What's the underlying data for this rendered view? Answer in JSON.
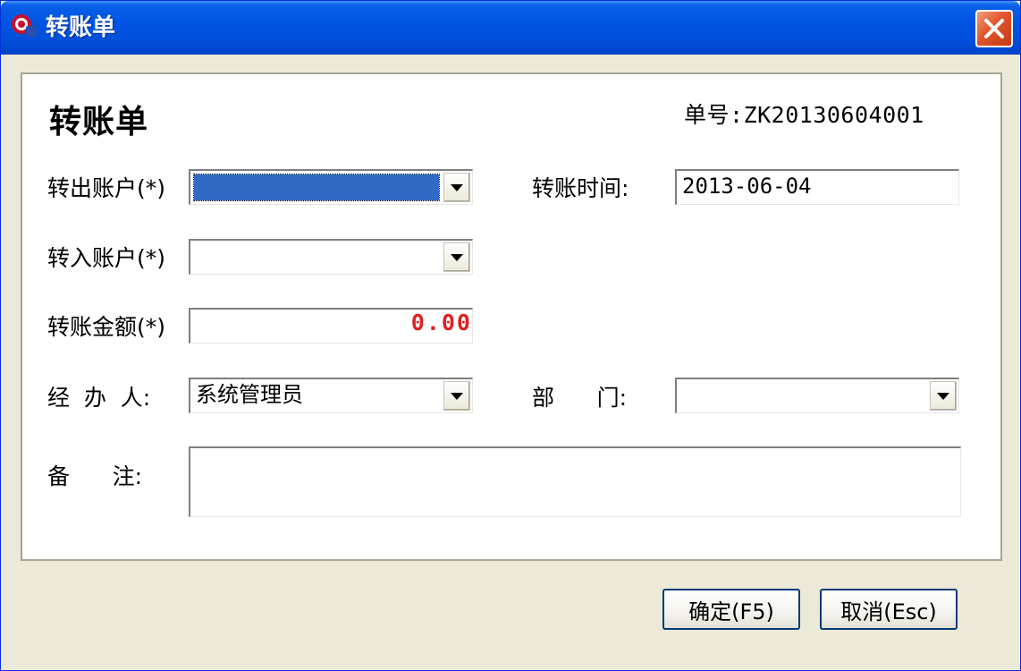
{
  "window": {
    "title": "转账单",
    "close_label": "✕"
  },
  "form": {
    "heading": "转账单",
    "order_no_label": "单号:",
    "order_no_value": "ZK20130604001",
    "from_account": {
      "label": "转出账户(*)",
      "value": ""
    },
    "to_account": {
      "label": "转入账户(*)",
      "value": ""
    },
    "amount": {
      "label": "转账金额(*)",
      "value": "0.00"
    },
    "time": {
      "label": "转账时间:",
      "value": "2013-06-04"
    },
    "handler": {
      "label": "经  办  人:",
      "value": "系统管理员"
    },
    "department": {
      "label": "部      门:",
      "value": ""
    },
    "remark": {
      "label": "备      注:",
      "value": ""
    }
  },
  "buttons": {
    "ok_label": "确定(F5)",
    "cancel_label": "取消(Esc)"
  },
  "colors": {
    "titlebar": "#0054e3",
    "selection": "#316ac5",
    "amount": "#e02020",
    "close": "#e2542c"
  }
}
